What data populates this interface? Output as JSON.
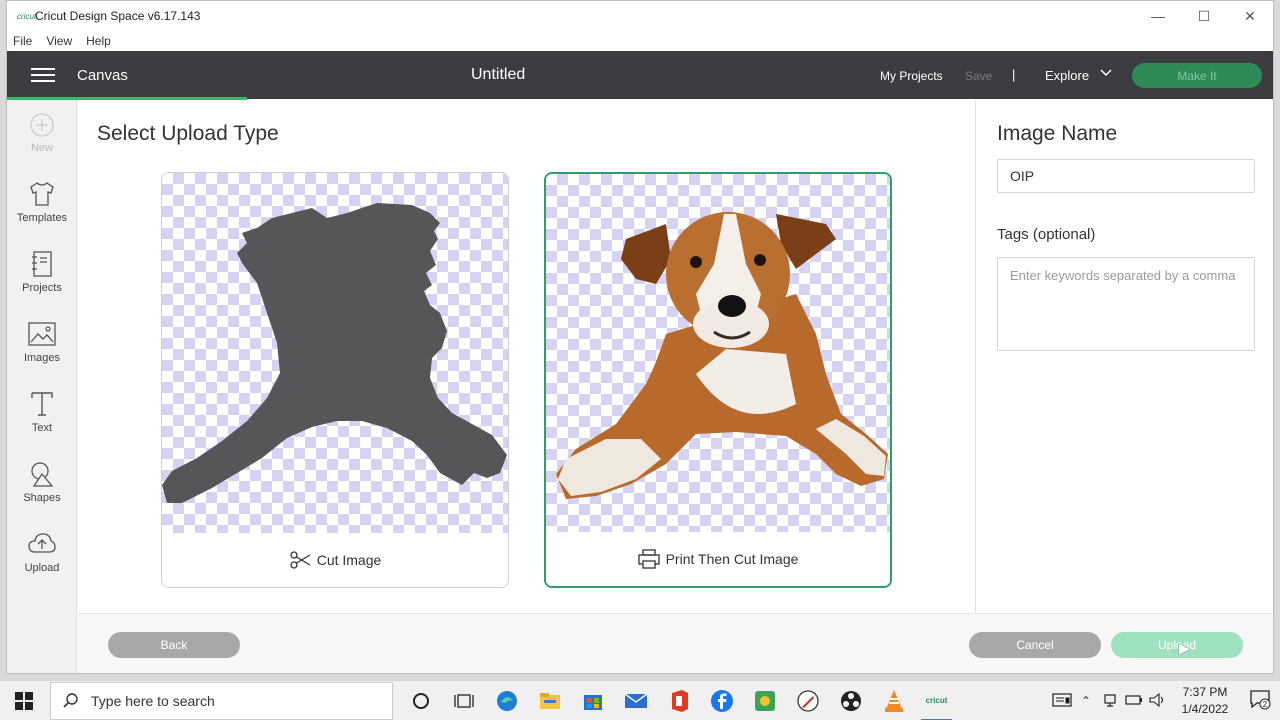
{
  "window": {
    "title": "Cricut Design Space  v6.17.143",
    "logo_text": "cricut"
  },
  "menu": {
    "file": "File",
    "view": "View",
    "help": "Help"
  },
  "header": {
    "section": "Canvas",
    "doc_title": "Untitled",
    "my_projects": "My Projects",
    "save": "Save",
    "separator": "|",
    "explore": "Explore",
    "make_it": "Make It"
  },
  "sidebar": {
    "new": "New",
    "templates": "Templates",
    "projects": "Projects",
    "images": "Images",
    "text": "Text",
    "shapes": "Shapes",
    "upload": "Upload"
  },
  "main": {
    "title": "Select Upload Type",
    "cut_label": "Cut Image",
    "print_label": "Print Then Cut Image",
    "selected": "Print Then Cut Image"
  },
  "right": {
    "image_name_label": "Image Name",
    "image_name_value": "OIP",
    "tags_label": "Tags (optional)",
    "tags_placeholder": "Enter keywords separated by a comma"
  },
  "buttons": {
    "back": "Back",
    "cancel": "Cancel",
    "upload": "Upload"
  },
  "taskbar": {
    "search_placeholder": "Type here to search",
    "time": "7:37 PM",
    "date": "1/4/2022",
    "notification_count": "2",
    "cricut_label": "cricut"
  },
  "colors": {
    "accent": "#2e8b57",
    "header": "#3a3c40",
    "checker": "#d6d2f1"
  }
}
